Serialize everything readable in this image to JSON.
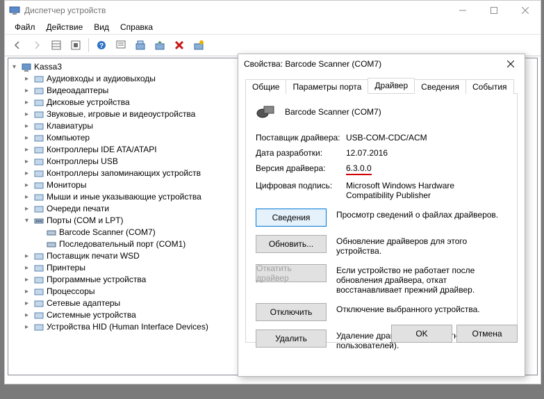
{
  "window": {
    "title": "Диспетчер устройств"
  },
  "menu": {
    "file": "Файл",
    "action": "Действие",
    "view": "Вид",
    "help": "Справка"
  },
  "tree": {
    "root": "Kassa3",
    "items": [
      "Аудиовходы и аудиовыходы",
      "Видеоадаптеры",
      "Дисковые устройства",
      "Звуковые, игровые и видеоустройства",
      "Клавиатуры",
      "Компьютер",
      "Контроллеры IDE ATA/ATAPI",
      "Контроллеры USB",
      "Контроллеры запоминающих устройств",
      "Мониторы",
      "Мыши и иные указывающие устройства",
      "Очереди печати",
      "Порты (COM и LPT)",
      "Поставщик печати WSD",
      "Принтеры",
      "Программные устройства",
      "Процессоры",
      "Сетевые адаптеры",
      "Системные устройства",
      "Устройства HID (Human Interface Devices)"
    ],
    "ports_children": {
      "barcode": "Barcode Scanner (COM7)",
      "serial": "Последовательный порт (COM1)"
    }
  },
  "dialog": {
    "title": "Свойства: Barcode Scanner (COM7)",
    "tabs": {
      "general": "Общие",
      "port": "Параметры порта",
      "driver": "Драйвер",
      "details": "Сведения",
      "events": "События"
    },
    "device_name": "Barcode Scanner (COM7)",
    "labels": {
      "provider": "Поставщик драйвера:",
      "date": "Дата разработки:",
      "version": "Версия драйвера:",
      "signature": "Цифровая подпись:"
    },
    "values": {
      "provider": "USB-COM-CDC/ACM",
      "date": "12.07.2016",
      "version": "6.3.0.0",
      "signature": "Microsoft Windows Hardware Compatibility Publisher"
    },
    "buttons": {
      "details": "Сведения",
      "update": "Обновить...",
      "rollback": "Откатить драйвер",
      "disable": "Отключить",
      "uninstall": "Удалить"
    },
    "descriptions": {
      "details": "Просмотр сведений о файлах драйверов.",
      "update": "Обновление драйверов для этого устройства.",
      "rollback": "Если устройство не работает после обновления драйвера, откат восстанавливает прежний драйвер.",
      "disable": "Отключение выбранного устройства.",
      "uninstall": "Удаление драйвера (для опытных пользователей)."
    },
    "footer": {
      "ok": "OK",
      "cancel": "Отмена"
    }
  }
}
